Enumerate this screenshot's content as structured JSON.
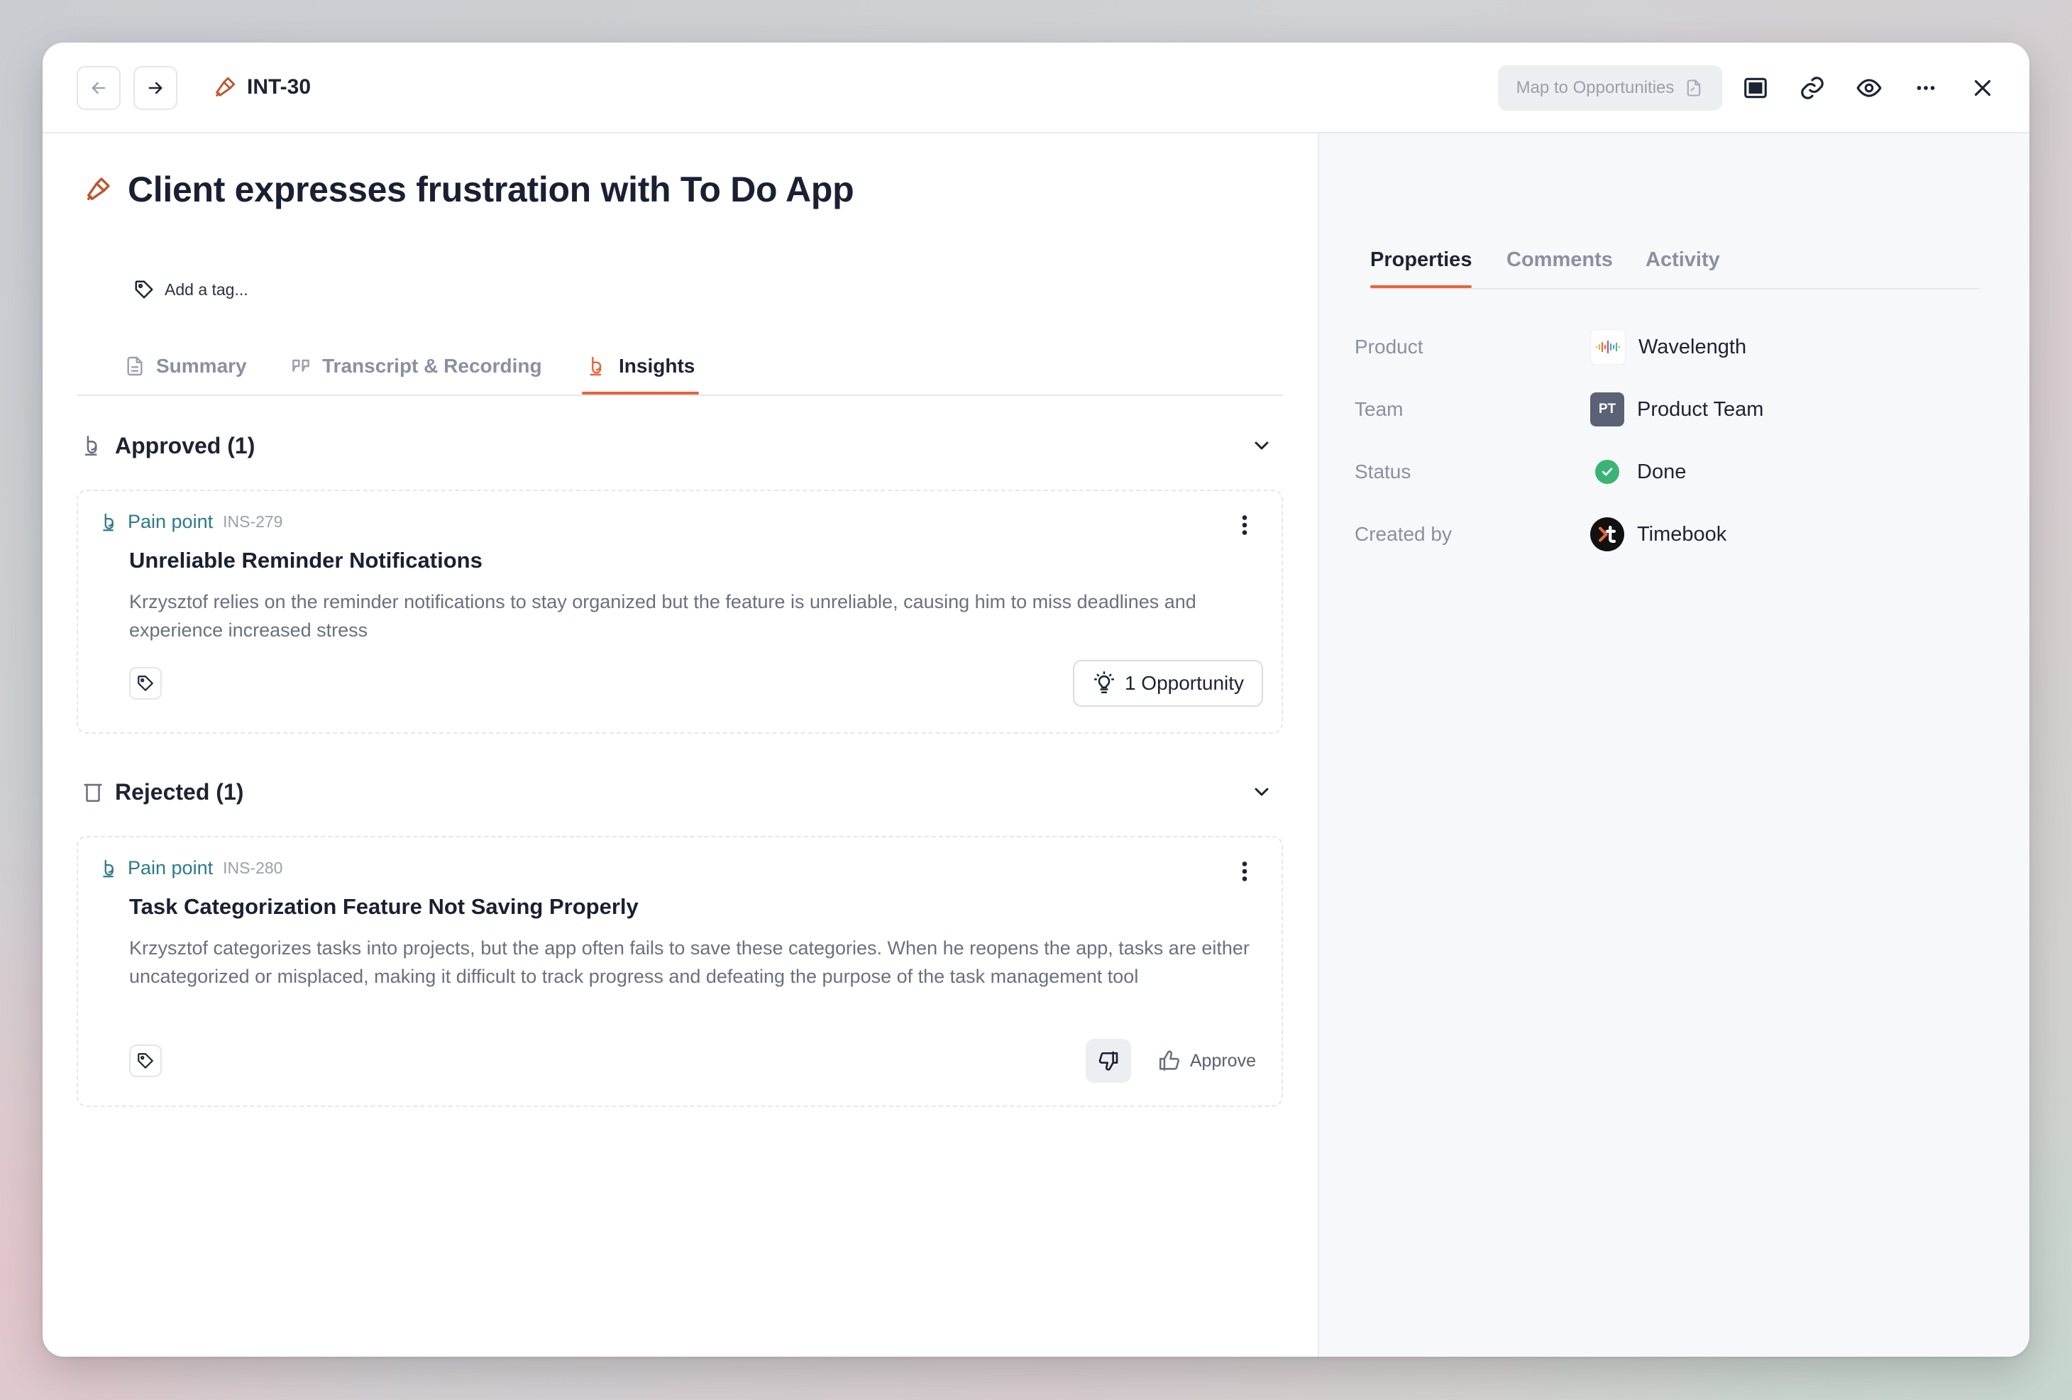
{
  "header": {
    "breadcrumb_id": "INT-30",
    "map_button_label": "Map to Opportunities"
  },
  "main": {
    "title": "Client expresses frustration with To Do App",
    "add_tag_label": "Add a tag...",
    "tabs": [
      {
        "label": "Summary",
        "active": false
      },
      {
        "label": "Transcript & Recording",
        "active": false
      },
      {
        "label": "Insights",
        "active": true
      }
    ],
    "sections": {
      "approved": {
        "heading": "Approved (1)",
        "card": {
          "type": "Pain point",
          "id": "INS-279",
          "title": "Unreliable Reminder Notifications",
          "description": "Krzysztof relies on the reminder notifications to stay organized but the feature is unreliable, causing him to miss deadlines and experience increased stress",
          "opportunity_label": "1 Opportunity"
        }
      },
      "rejected": {
        "heading": "Rejected (1)",
        "card": {
          "type": "Pain point",
          "id": "INS-280",
          "title": "Task Categorization Feature Not Saving Properly",
          "description": "Krzysztof categorizes tasks into projects, but the app often fails to save these categories. When he reopens the app, tasks are either uncategorized or misplaced, making it difficult to track progress and defeating the purpose of the task management tool",
          "approve_label": "Approve"
        }
      }
    }
  },
  "sidebar": {
    "tabs": [
      {
        "label": "Properties",
        "active": true
      },
      {
        "label": "Comments",
        "active": false
      },
      {
        "label": "Activity",
        "active": false
      }
    ],
    "properties": [
      {
        "label": "Product",
        "value": "Wavelength",
        "icon": "wavelength-logo-icon"
      },
      {
        "label": "Team",
        "value": "Product Team",
        "icon_text": "PT"
      },
      {
        "label": "Status",
        "value": "Done",
        "icon": "check-circle-icon"
      },
      {
        "label": "Created by",
        "value": "Timebook",
        "icon": "timebook-logo-icon"
      }
    ]
  },
  "colors": {
    "accent": "#e8643c",
    "pain_point": "#2b7a8a",
    "status_done": "#3bb374"
  }
}
